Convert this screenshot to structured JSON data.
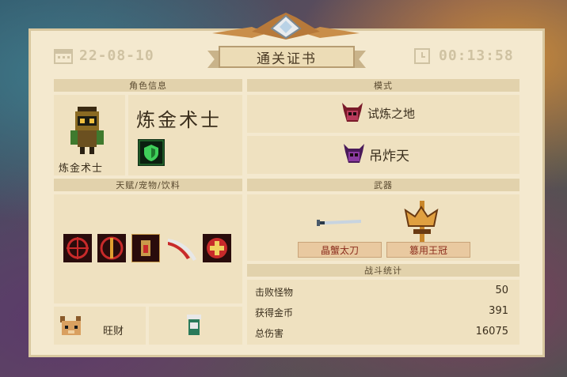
{
  "certificate": {
    "title": "通关证书",
    "date": "22-08-10",
    "time": "00:13:58"
  },
  "character": {
    "header": "角色信息",
    "name": "炼金术士",
    "label": "炼金术士"
  },
  "mode": {
    "header": "模式",
    "items": [
      {
        "label": "试炼之地",
        "icon": "demon-mask-icon"
      },
      {
        "label": "吊炸天",
        "icon": "demon-mask-icon"
      }
    ]
  },
  "talents": {
    "header": "天赋/宠物/饮料",
    "icons": [
      "crosshair-icon",
      "sword-ring-icon",
      "potion-icon",
      "slash-icon",
      "cross-heal-icon"
    ]
  },
  "pet": {
    "name": "旺财"
  },
  "weapons": {
    "header": "武器",
    "items": [
      {
        "name": "晶蟹太刀"
      },
      {
        "name": "篡用王冠"
      }
    ]
  },
  "stats": {
    "header": "战斗统计",
    "rows": [
      {
        "label": "击败怪物",
        "value": "50"
      },
      {
        "label": "获得金币",
        "value": "391"
      },
      {
        "label": "总伤害",
        "value": "16075"
      }
    ]
  },
  "colors": {
    "paper": "#f4e9cf",
    "header": "#e2d2ac",
    "accent": "#8a2c1c"
  }
}
